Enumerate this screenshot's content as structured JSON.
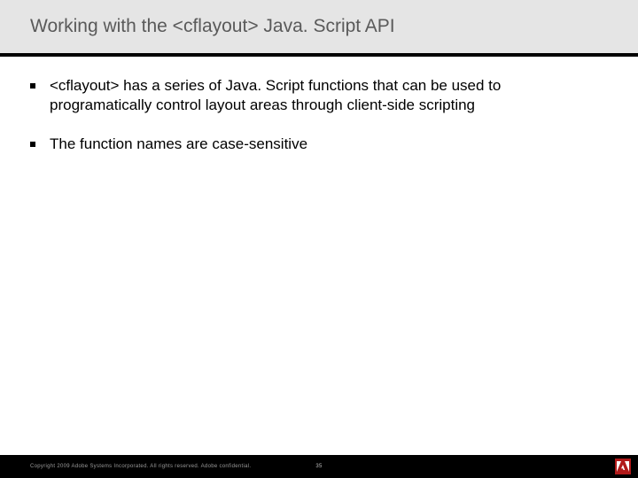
{
  "title": "Working with the <cflayout> Java. Script API",
  "bullets": [
    "<cflayout> has a series of Java. Script functions that can be used to programatically control layout areas through client-side scripting",
    "The function names are case-sensitive"
  ],
  "footer": {
    "copyright": "Copyright 2009 Adobe Systems Incorporated.  All rights reserved.  Adobe confidential.",
    "page": "35"
  }
}
